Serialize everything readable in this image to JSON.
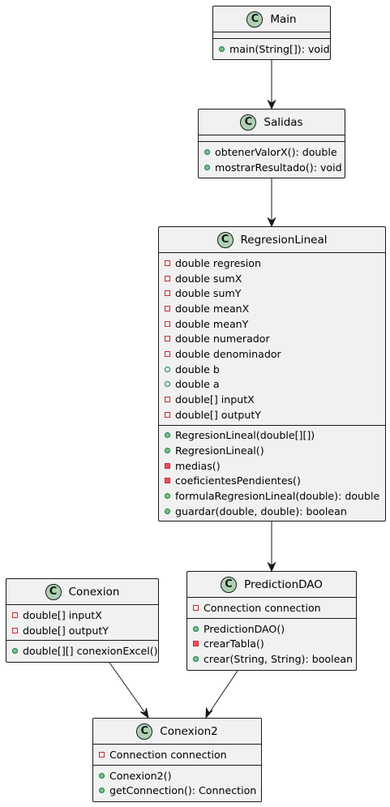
{
  "colors": {
    "class_fill": "#f1f1f1",
    "border": "#181818",
    "class_icon": "#add1b2",
    "public": "#84be84",
    "private": "#c82930"
  },
  "classes": {
    "main": {
      "name": "Main",
      "icon": "C",
      "attributes": [],
      "methods": [
        {
          "vis": "public",
          "text": "main(String[]): void"
        }
      ]
    },
    "salidas": {
      "name": "Salidas",
      "icon": "C",
      "attributes": [],
      "methods": [
        {
          "vis": "public",
          "text": "obtenerValorX(): double"
        },
        {
          "vis": "public",
          "text": "mostrarResultado(): void"
        }
      ]
    },
    "regresion": {
      "name": "RegresionLineal",
      "icon": "C",
      "attributes": [
        {
          "vis": "private",
          "text": "double regresion"
        },
        {
          "vis": "private",
          "text": "double sumX"
        },
        {
          "vis": "private",
          "text": "double sumY"
        },
        {
          "vis": "private",
          "text": "double meanX"
        },
        {
          "vis": "private",
          "text": "double meanY"
        },
        {
          "vis": "private",
          "text": "double numerador"
        },
        {
          "vis": "private",
          "text": "double denominador"
        },
        {
          "vis": "public",
          "text": "double b"
        },
        {
          "vis": "public",
          "text": "double a"
        },
        {
          "vis": "private",
          "text": "double[] inputX"
        },
        {
          "vis": "private",
          "text": "double[] outputY"
        }
      ],
      "methods": [
        {
          "vis": "public",
          "text": "RegresionLineal(double[][])"
        },
        {
          "vis": "public",
          "text": "RegresionLineal()"
        },
        {
          "vis": "private",
          "text": "medias()"
        },
        {
          "vis": "private",
          "text": "coeficientesPendientes()"
        },
        {
          "vis": "public",
          "text": "formulaRegresionLineal(double): double"
        },
        {
          "vis": "public",
          "text": "guardar(double, double): boolean"
        }
      ]
    },
    "conexion": {
      "name": "Conexion",
      "icon": "C",
      "attributes": [
        {
          "vis": "private",
          "text": "double[] inputX"
        },
        {
          "vis": "private",
          "text": "double[] outputY"
        }
      ],
      "methods": [
        {
          "vis": "public",
          "text": "double[][] conexionExcel()"
        }
      ]
    },
    "prediction": {
      "name": "PredictionDAO",
      "icon": "C",
      "attributes": [
        {
          "vis": "private",
          "text": "Connection connection"
        }
      ],
      "methods": [
        {
          "vis": "public",
          "text": "PredictionDAO()"
        },
        {
          "vis": "private",
          "text": "crearTabla()"
        },
        {
          "vis": "public",
          "text": "crear(String, String): boolean"
        }
      ]
    },
    "conexion2": {
      "name": "Conexion2",
      "icon": "C",
      "attributes": [
        {
          "vis": "private",
          "text": "Connection connection"
        }
      ],
      "methods": [
        {
          "vis": "public",
          "text": "Conexion2()"
        },
        {
          "vis": "public",
          "text": "getConnection(): Connection"
        }
      ]
    }
  },
  "relations": [
    {
      "from": "Main",
      "to": "Salidas"
    },
    {
      "from": "Salidas",
      "to": "RegresionLineal"
    },
    {
      "from": "RegresionLineal",
      "to": "PredictionDAO"
    },
    {
      "from": "Conexion",
      "to": "Conexion2"
    },
    {
      "from": "PredictionDAO",
      "to": "Conexion2"
    }
  ]
}
